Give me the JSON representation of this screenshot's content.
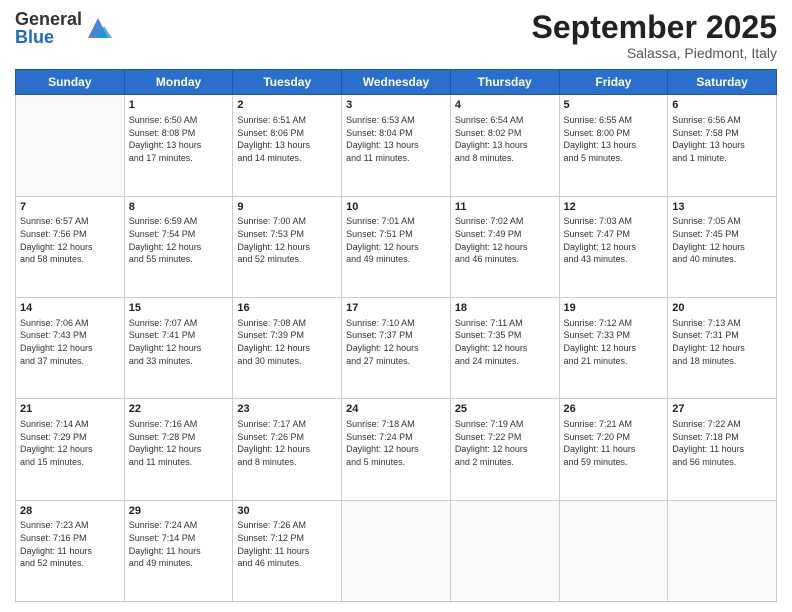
{
  "logo": {
    "general": "General",
    "blue": "Blue"
  },
  "title": "September 2025",
  "subtitle": "Salassa, Piedmont, Italy",
  "days": [
    "Sunday",
    "Monday",
    "Tuesday",
    "Wednesday",
    "Thursday",
    "Friday",
    "Saturday"
  ],
  "weeks": [
    [
      {
        "num": "",
        "info": ""
      },
      {
        "num": "1",
        "info": "Sunrise: 6:50 AM\nSunset: 8:08 PM\nDaylight: 13 hours\nand 17 minutes."
      },
      {
        "num": "2",
        "info": "Sunrise: 6:51 AM\nSunset: 8:06 PM\nDaylight: 13 hours\nand 14 minutes."
      },
      {
        "num": "3",
        "info": "Sunrise: 6:53 AM\nSunset: 8:04 PM\nDaylight: 13 hours\nand 11 minutes."
      },
      {
        "num": "4",
        "info": "Sunrise: 6:54 AM\nSunset: 8:02 PM\nDaylight: 13 hours\nand 8 minutes."
      },
      {
        "num": "5",
        "info": "Sunrise: 6:55 AM\nSunset: 8:00 PM\nDaylight: 13 hours\nand 5 minutes."
      },
      {
        "num": "6",
        "info": "Sunrise: 6:56 AM\nSunset: 7:58 PM\nDaylight: 13 hours\nand 1 minute."
      }
    ],
    [
      {
        "num": "7",
        "info": "Sunrise: 6:57 AM\nSunset: 7:56 PM\nDaylight: 12 hours\nand 58 minutes."
      },
      {
        "num": "8",
        "info": "Sunrise: 6:59 AM\nSunset: 7:54 PM\nDaylight: 12 hours\nand 55 minutes."
      },
      {
        "num": "9",
        "info": "Sunrise: 7:00 AM\nSunset: 7:53 PM\nDaylight: 12 hours\nand 52 minutes."
      },
      {
        "num": "10",
        "info": "Sunrise: 7:01 AM\nSunset: 7:51 PM\nDaylight: 12 hours\nand 49 minutes."
      },
      {
        "num": "11",
        "info": "Sunrise: 7:02 AM\nSunset: 7:49 PM\nDaylight: 12 hours\nand 46 minutes."
      },
      {
        "num": "12",
        "info": "Sunrise: 7:03 AM\nSunset: 7:47 PM\nDaylight: 12 hours\nand 43 minutes."
      },
      {
        "num": "13",
        "info": "Sunrise: 7:05 AM\nSunset: 7:45 PM\nDaylight: 12 hours\nand 40 minutes."
      }
    ],
    [
      {
        "num": "14",
        "info": "Sunrise: 7:06 AM\nSunset: 7:43 PM\nDaylight: 12 hours\nand 37 minutes."
      },
      {
        "num": "15",
        "info": "Sunrise: 7:07 AM\nSunset: 7:41 PM\nDaylight: 12 hours\nand 33 minutes."
      },
      {
        "num": "16",
        "info": "Sunrise: 7:08 AM\nSunset: 7:39 PM\nDaylight: 12 hours\nand 30 minutes."
      },
      {
        "num": "17",
        "info": "Sunrise: 7:10 AM\nSunset: 7:37 PM\nDaylight: 12 hours\nand 27 minutes."
      },
      {
        "num": "18",
        "info": "Sunrise: 7:11 AM\nSunset: 7:35 PM\nDaylight: 12 hours\nand 24 minutes."
      },
      {
        "num": "19",
        "info": "Sunrise: 7:12 AM\nSunset: 7:33 PM\nDaylight: 12 hours\nand 21 minutes."
      },
      {
        "num": "20",
        "info": "Sunrise: 7:13 AM\nSunset: 7:31 PM\nDaylight: 12 hours\nand 18 minutes."
      }
    ],
    [
      {
        "num": "21",
        "info": "Sunrise: 7:14 AM\nSunset: 7:29 PM\nDaylight: 12 hours\nand 15 minutes."
      },
      {
        "num": "22",
        "info": "Sunrise: 7:16 AM\nSunset: 7:28 PM\nDaylight: 12 hours\nand 11 minutes."
      },
      {
        "num": "23",
        "info": "Sunrise: 7:17 AM\nSunset: 7:26 PM\nDaylight: 12 hours\nand 8 minutes."
      },
      {
        "num": "24",
        "info": "Sunrise: 7:18 AM\nSunset: 7:24 PM\nDaylight: 12 hours\nand 5 minutes."
      },
      {
        "num": "25",
        "info": "Sunrise: 7:19 AM\nSunset: 7:22 PM\nDaylight: 12 hours\nand 2 minutes."
      },
      {
        "num": "26",
        "info": "Sunrise: 7:21 AM\nSunset: 7:20 PM\nDaylight: 11 hours\nand 59 minutes."
      },
      {
        "num": "27",
        "info": "Sunrise: 7:22 AM\nSunset: 7:18 PM\nDaylight: 11 hours\nand 56 minutes."
      }
    ],
    [
      {
        "num": "28",
        "info": "Sunrise: 7:23 AM\nSunset: 7:16 PM\nDaylight: 11 hours\nand 52 minutes."
      },
      {
        "num": "29",
        "info": "Sunrise: 7:24 AM\nSunset: 7:14 PM\nDaylight: 11 hours\nand 49 minutes."
      },
      {
        "num": "30",
        "info": "Sunrise: 7:26 AM\nSunset: 7:12 PM\nDaylight: 11 hours\nand 46 minutes."
      },
      {
        "num": "",
        "info": ""
      },
      {
        "num": "",
        "info": ""
      },
      {
        "num": "",
        "info": ""
      },
      {
        "num": "",
        "info": ""
      }
    ]
  ]
}
